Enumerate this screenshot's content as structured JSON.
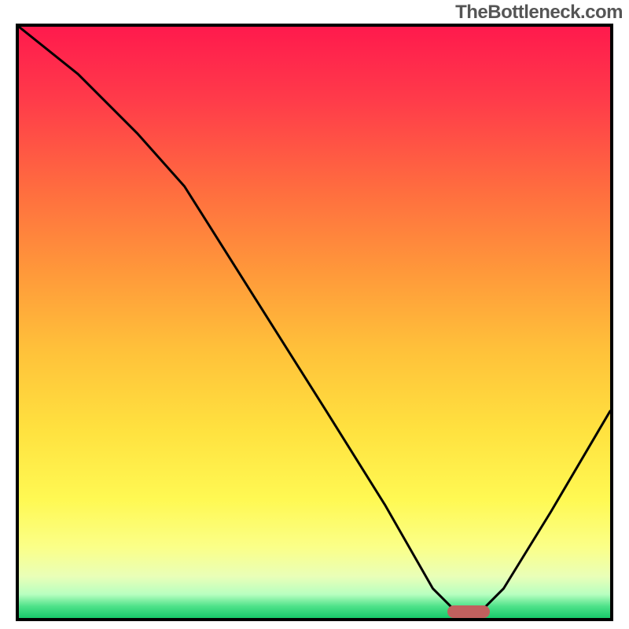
{
  "watermark": "TheBottleneck.com",
  "chart_data": {
    "type": "line",
    "title": "",
    "xlabel": "",
    "ylabel": "",
    "xlim": [
      0,
      100
    ],
    "ylim": [
      0,
      100
    ],
    "x": [
      0,
      10,
      20,
      28,
      40,
      52,
      62,
      70,
      74,
      78,
      82,
      90,
      100
    ],
    "values": [
      100,
      92,
      82,
      73,
      54,
      35,
      19,
      5,
      1,
      1,
      5,
      18,
      35
    ],
    "marker": {
      "x": 76,
      "y": 1
    },
    "gradient_stops": [
      {
        "pos": 0,
        "color": "#ff1a4d"
      },
      {
        "pos": 12,
        "color": "#ff3a4a"
      },
      {
        "pos": 28,
        "color": "#ff6e3f"
      },
      {
        "pos": 42,
        "color": "#ff9a3a"
      },
      {
        "pos": 55,
        "color": "#ffc23a"
      },
      {
        "pos": 68,
        "color": "#ffe13f"
      },
      {
        "pos": 80,
        "color": "#fff953"
      },
      {
        "pos": 88,
        "color": "#fbff88"
      },
      {
        "pos": 93,
        "color": "#e9ffb8"
      },
      {
        "pos": 96,
        "color": "#b8ffc0"
      },
      {
        "pos": 98,
        "color": "#4fe28a"
      },
      {
        "pos": 100,
        "color": "#18c96a"
      }
    ]
  },
  "plot": {
    "inner_width": 752,
    "inner_height": 752
  }
}
